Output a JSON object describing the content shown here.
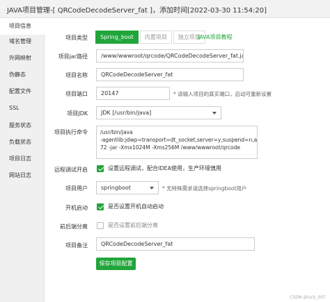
{
  "window": {
    "title": "JAVA项目管理-[ QRCodeDecodeServer_fat ]，添加时间[2022-03-30 11:54:20]"
  },
  "sidebar": {
    "items": [
      {
        "label": "项目信息",
        "active": true
      },
      {
        "label": "域名管理"
      },
      {
        "label": "外网映射"
      },
      {
        "label": "伪静态"
      },
      {
        "label": "配置文件"
      },
      {
        "label": "SSL"
      },
      {
        "label": "服务状态"
      },
      {
        "label": "负载状态"
      },
      {
        "label": "项目日志"
      },
      {
        "label": "网站日志"
      }
    ]
  },
  "form": {
    "project_type": {
      "label": "项目类型",
      "options": [
        "Spring_boot",
        "内置项目",
        "独立项目"
      ],
      "selected": "Spring_boot",
      "tutorial_link": "JAVA项目教程"
    },
    "jar_path": {
      "label": "项目jar路径",
      "value": "/www/wwwroot/qrcode/QRCodeDecodeServer_fat.jar"
    },
    "project_name": {
      "label": "项目名称",
      "value": "QRCodeDecodeServer_fat"
    },
    "project_port": {
      "label": "项目端口",
      "value": "20147",
      "hint": "* 请输入项目的真实端口，启动可重新设置"
    },
    "project_jdk": {
      "label": "项目JDK",
      "value": "JDK [/usr/bin/java]"
    },
    "exec_command": {
      "label": "项目执行命令",
      "lines": [
        "/usr/bin/java",
        "-agentlib:jdwp=transport=dt_socket,server=y,suspend=n,address=99",
        "72 -jar -Xmx1024M -Xms256M  /www/wwwroot/qrcode"
      ]
    },
    "remote_debug": {
      "label": "远程调试开启",
      "text": "设置远程调试，配合IDEA使用，生产环境慎用",
      "checked": true
    },
    "project_user": {
      "label": "项目用户",
      "value": "springboot",
      "hint": "* 无特殊需求请选择springboot用户"
    },
    "autostart": {
      "label": "开机启动",
      "text": "是否设置开机自动启动",
      "checked": true
    },
    "frontend_separation": {
      "label": "前后端分离",
      "text": "是否设置前后端分离",
      "checked": false
    },
    "project_note": {
      "label": "项目备注",
      "value": "QRCodeDecodeServer_fat"
    },
    "save_label": "保存项目配置"
  },
  "watermark": "CSDN @luck_007",
  "colors": {
    "accent": "#20a53a",
    "sidebar_bg": "#f0f0f0",
    "titlebar_bg": "#f2f2f2"
  }
}
